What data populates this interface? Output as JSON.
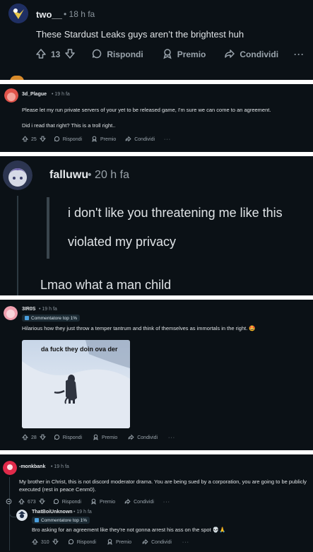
{
  "comments": [
    {
      "author": "two__",
      "time": "• 18 h fa",
      "text": "These Stardust Leaks guys aren’t the brightest huh",
      "votes": "13",
      "reply": "Rispondi",
      "award": "Premio",
      "share": "Condividi",
      "more": "···"
    },
    {
      "author": "3d_Plague",
      "time": "• 19 h fa",
      "text1": "Please let my run private servers of your yet to be released game, I'm sure we can come to an agreement.",
      "text2": "Did i read that right? This is a troll right..",
      "votes": "25",
      "reply": "Rispondi",
      "award": "Premio",
      "share": "Condividi",
      "more": "···"
    },
    {
      "author": "falluwu",
      "time": "• 20 h fa",
      "quote1": "i don't like you threatening me like this",
      "quote2": "violated my privacy",
      "text": "Lmao what a man child"
    },
    {
      "author": "3IR0S",
      "time": "• 19 h fa",
      "badge": "Commentatore top 1%",
      "text": "Hilarious how they just throw a temper tantrum and think of themselves as immortals in the right. 🤩",
      "image_caption": "da fuck they doin ova der",
      "votes": "28",
      "reply": "Rispondi",
      "award": "Premio",
      "share": "Condividi",
      "more": "···"
    },
    {
      "author": "-monkbank",
      "time": "• 19 h fa",
      "text": "My brother in Christ, this is not discord moderator drama. You are being sued by a corporation, you are going to be publicly executed (rest in peace Cenm0).",
      "votes": "673",
      "reply": "Rispondi",
      "award": "Premio",
      "share": "Condividi",
      "more": "···"
    },
    {
      "author": "ThatBoiUnknown",
      "time": "• 19 h fa",
      "badge": "Commentatore top 1%",
      "text": "Bro asking for an agreement like they're not gonna arrest his ass on the spot 💀🙏",
      "votes": "310",
      "reply": "Rispondi",
      "award": "Premio",
      "share": "Condividi",
      "more": "···"
    }
  ]
}
